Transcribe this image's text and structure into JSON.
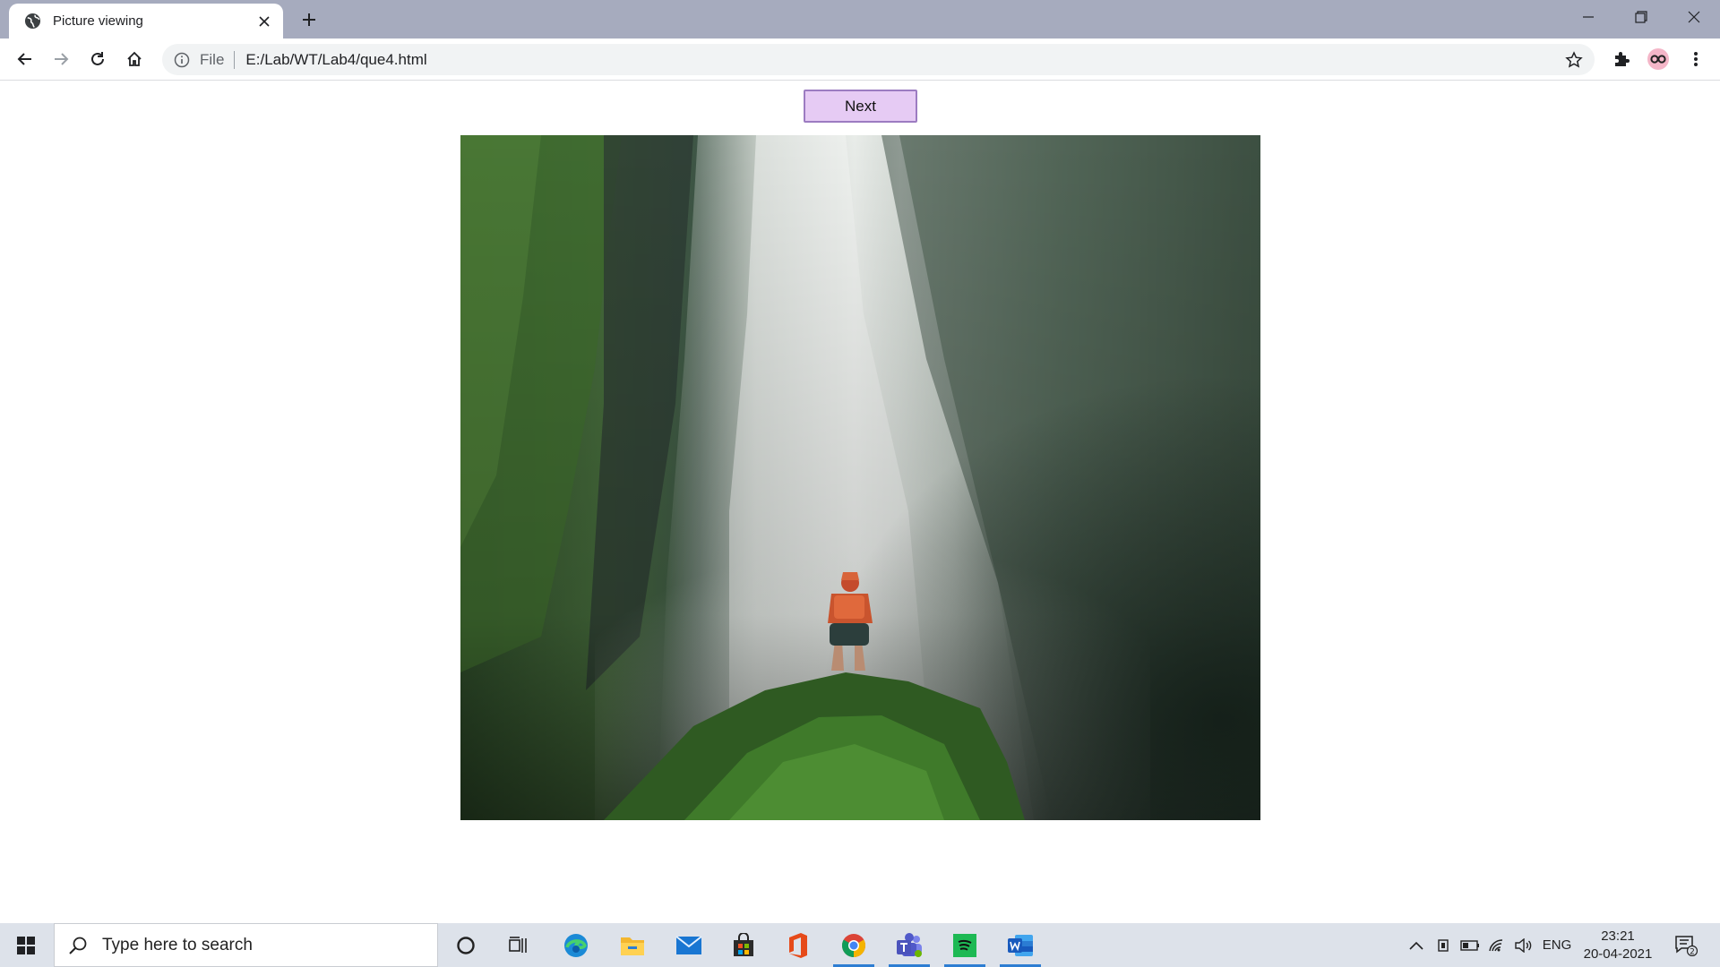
{
  "browser": {
    "tab_title": "Picture viewing",
    "omnibox": {
      "scheme_label": "File",
      "url": "E:/Lab/WT/Lab4/que4.html"
    }
  },
  "page": {
    "next_button_label": "Next",
    "image_alt": "Hiker in an orange jacket standing on a mossy rock facing a large waterfall between green cliffs"
  },
  "taskbar": {
    "search_placeholder": "Type here to search",
    "language": "ENG",
    "time": "23:21",
    "date": "20-04-2021",
    "notification_count": "2",
    "apps": [
      "cortana",
      "task-view",
      "edge",
      "file-explorer",
      "mail",
      "store",
      "office",
      "chrome",
      "teams",
      "spotify",
      "word"
    ]
  },
  "colors": {
    "titlebar": "#a6abbe",
    "next_button_bg": "#e6cbf4",
    "next_button_border": "#9c7cc1",
    "taskbar": "#dde2ea",
    "taskbar_active_indicator": "#2d7dd2"
  }
}
